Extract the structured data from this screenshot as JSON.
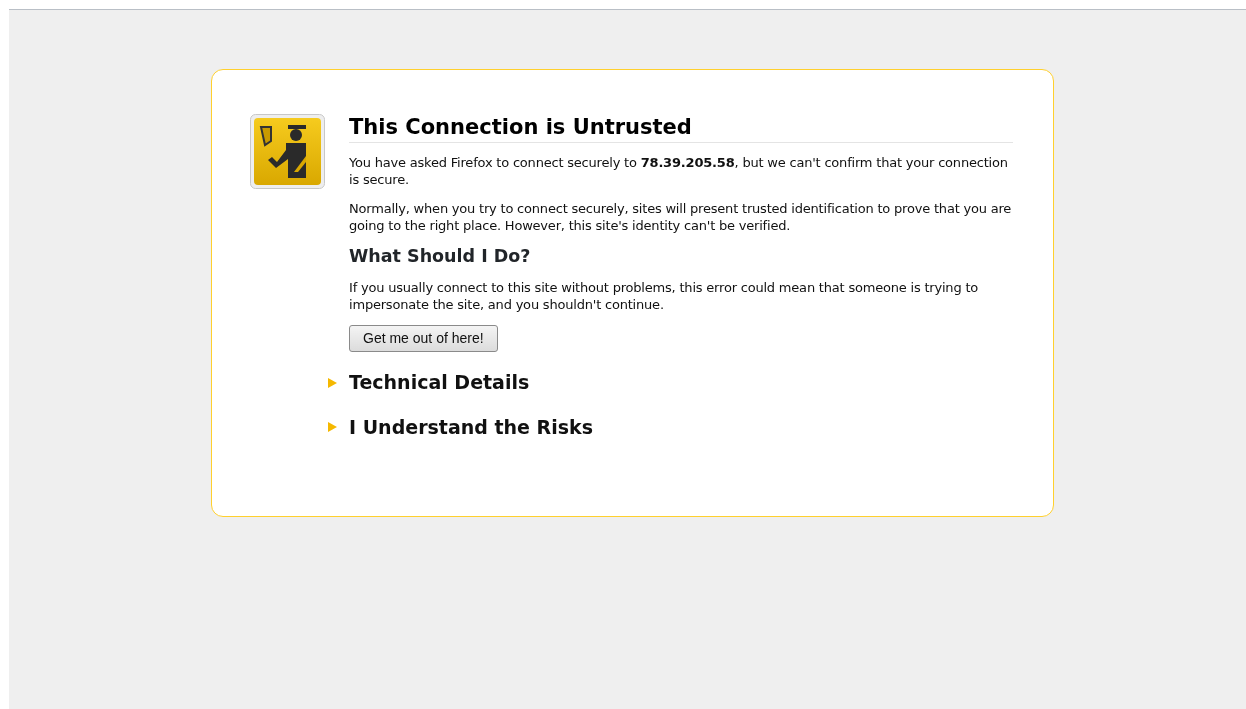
{
  "title": "This Connection is Untrusted",
  "intro": "You have asked Firefox to connect securely to **78.39.205.58**, but we can't confirm that your connection is secure.",
  "explanation": "Normally, when you try to connect securely, sites will present trusted identification to prove that you are going to the right place. However, this site's identity can't be verified.",
  "what_heading": "What Should I Do?",
  "advice": "If you usually connect to this site without problems, this error could mean that someone is trying to impersonate the site, and you shouldn't continue.",
  "button": "Get me out of here!",
  "sections": [
    {
      "label": "Technical Details",
      "expanded": false
    },
    {
      "label": "I Understand the Risks",
      "expanded": false
    }
  ]
}
